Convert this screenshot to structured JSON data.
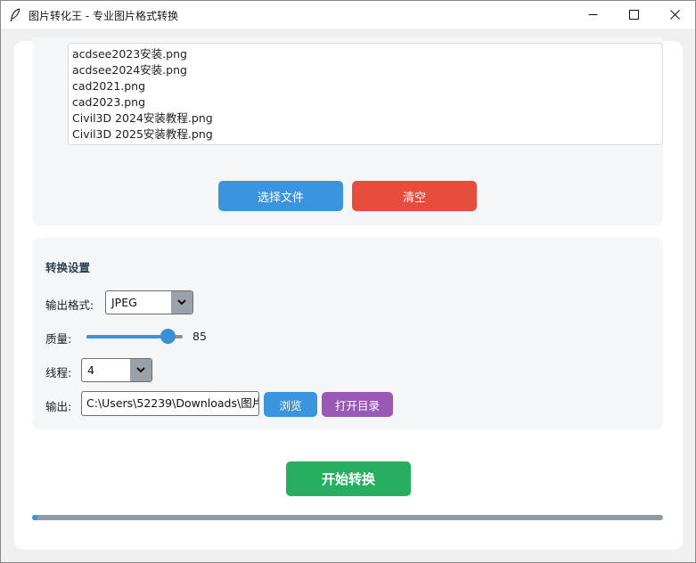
{
  "window": {
    "title": "图片转化王 - 专业图片格式转换",
    "controls": [
      "minimize-icon",
      "maximize-icon",
      "close-icon"
    ]
  },
  "files": {
    "items": [
      "acdsee2023安装.png",
      "acdsee2024安装.png",
      "cad2021.png",
      "cad2023.png",
      "Civil3D 2024安装教程.png",
      "Civil3D 2025安装教程.png"
    ],
    "select_label": "选择文件",
    "clear_label": "清空"
  },
  "settings": {
    "title": "转换设置",
    "format_label": "输出格式:",
    "format_value": "JPEG",
    "quality_label": "质量:",
    "quality_value": "85",
    "quality_fraction": 0.85,
    "threads_label": "线程:",
    "threads_value": "4",
    "output_label": "输出:",
    "output_path": "C:\\Users\\52239\\Downloads\\图片",
    "browse_label": "浏览",
    "open_dir_label": "打开目录"
  },
  "actions": {
    "start_label": "开始转换",
    "progress": 0.0
  },
  "colors": {
    "accent": "#3b95de",
    "danger": "#e74c3c",
    "purple": "#9b59b6",
    "success": "#27ae60"
  }
}
